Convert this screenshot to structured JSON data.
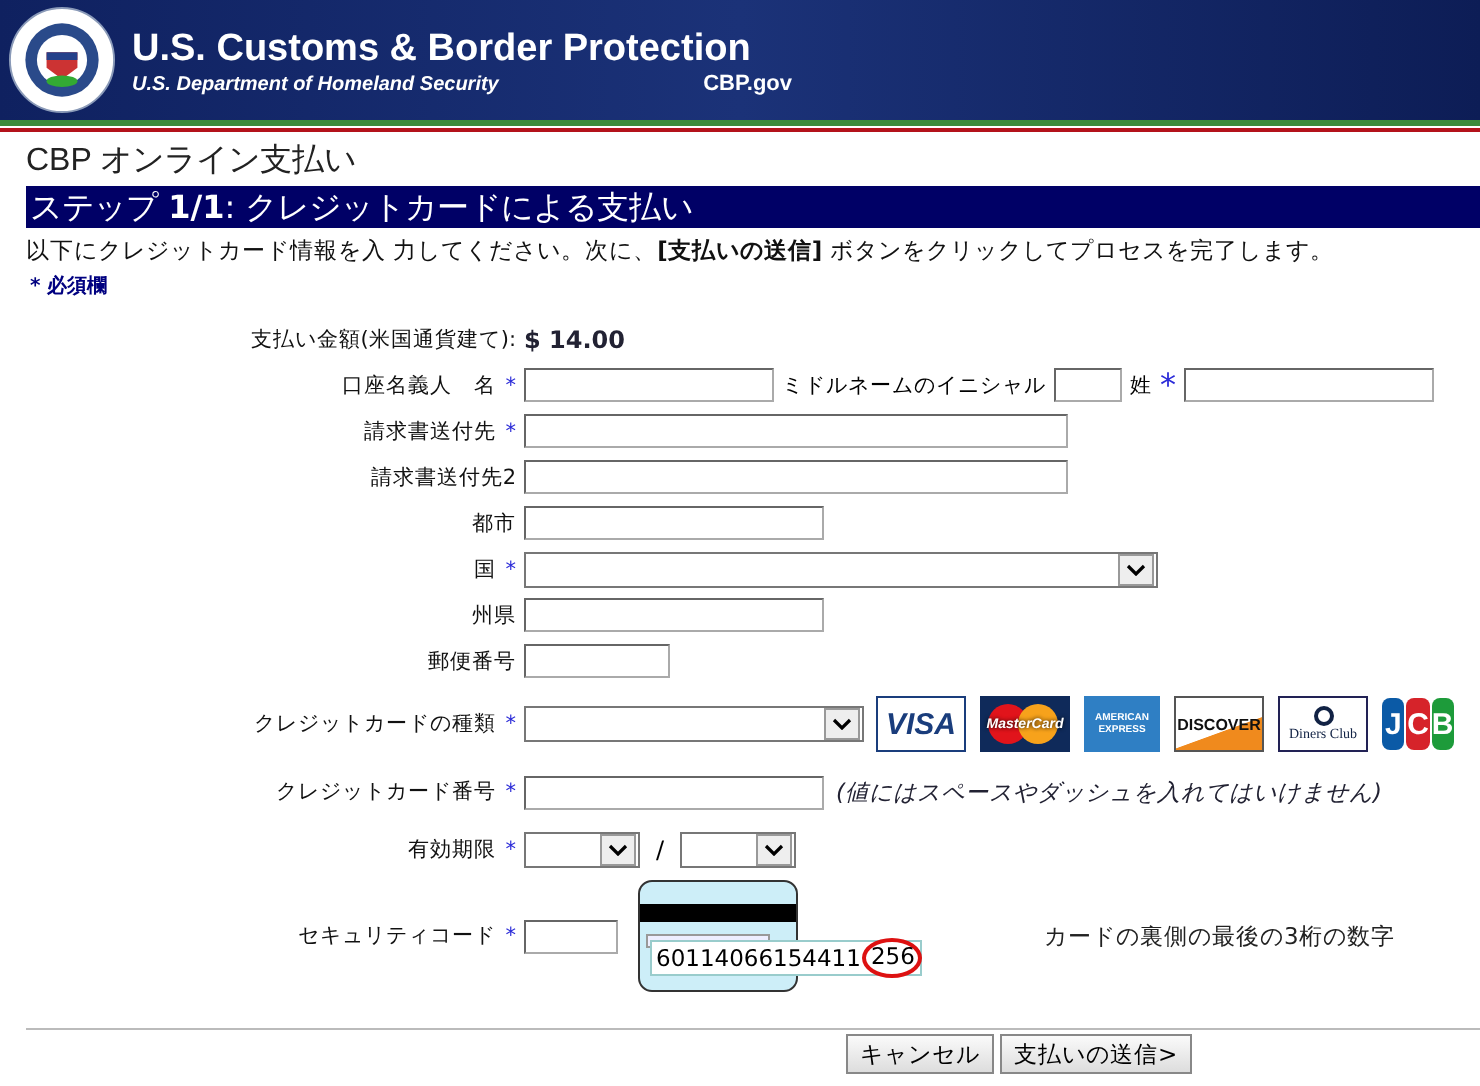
{
  "header": {
    "title": "U.S. Customs & Border Protection",
    "subtitle": "U.S. Department of Homeland Security",
    "site": "CBP.gov"
  },
  "page_title": "CBP オンライン支払い",
  "step_title": "ステップ **1/1**: クレジットカードによる支払い",
  "instructions": "以下にクレジットカード情報を入 力してください。次に、**[支払いの送信]** ボタンをクリックしてプロセスを完了します。",
  "required_note": "* 必須欄",
  "required_mark": "*",
  "amount": {
    "label": "支払い金額(米国通貨建て):",
    "value": "$ 14.00"
  },
  "rows": [
    {
      "kind": "name",
      "label": "口座名義人　名",
      "required": true,
      "middle_label": "ミドルネームのイニシャル",
      "last_label": "姓",
      "last_required": true
    },
    {
      "kind": "address",
      "label": "請求書送付先",
      "required": true
    },
    {
      "kind": "address",
      "label": "請求書送付先2",
      "required": false
    },
    {
      "kind": "city",
      "label": "都市",
      "required": false
    },
    {
      "kind": "country",
      "label": "国",
      "required": true
    },
    {
      "kind": "state",
      "label": "州県",
      "required": false
    },
    {
      "kind": "postal",
      "label": "郵便番号",
      "required": false
    },
    {
      "kind": "card_type",
      "label": "クレジットカードの種類",
      "required": true,
      "cards": [
        {
          "kind": "visa",
          "text": "VISA"
        },
        {
          "kind": "mastercard",
          "text": "MasterCard"
        },
        {
          "kind": "amex",
          "text": "AMERICAN EXPRESS"
        },
        {
          "kind": "discover",
          "text": "DISCOVER"
        },
        {
          "kind": "diners",
          "text": "Diners Club"
        },
        {
          "kind": "jcb",
          "text": "JCB"
        }
      ]
    },
    {
      "kind": "card_number",
      "label": "クレジットカード番号",
      "required": true,
      "note": "(値にはスペースやダッシュを入れてはいけません)"
    },
    {
      "kind": "expiry",
      "label": "有効期限",
      "required": true,
      "separator": "/"
    },
    {
      "kind": "cvv",
      "label": "セキュリティコード",
      "required": true,
      "card_number": "60114066154411",
      "code": "256",
      "hint": "カードの裏側の最後の3桁の数字"
    }
  ],
  "buttons": [
    "キャンセル",
    "支払いの送信>"
  ]
}
